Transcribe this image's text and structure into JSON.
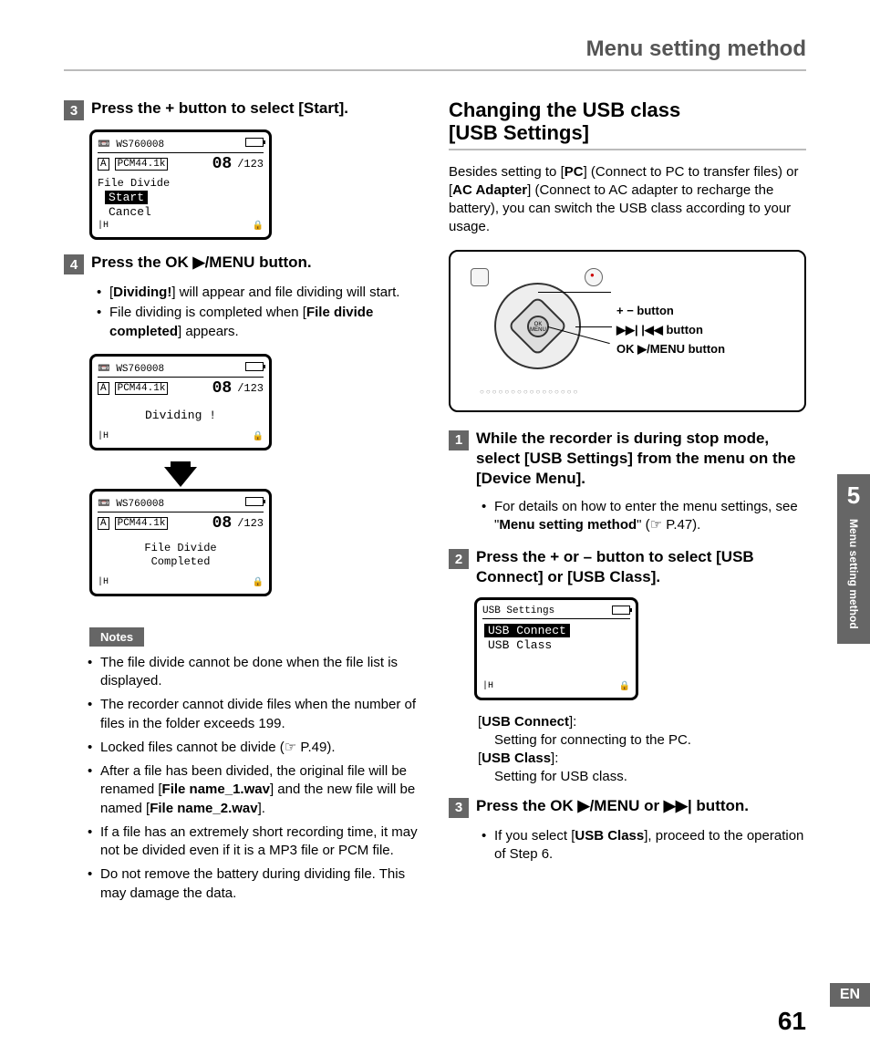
{
  "header": {
    "title": "Menu setting method"
  },
  "left": {
    "step3": {
      "num": "3",
      "text_a": "Press the ",
      "text_b": "+",
      "text_c": " button to select [",
      "text_d": "Start",
      "text_e": "]."
    },
    "screen1": {
      "fname": "WS760008",
      "folder": "A",
      "pcm": "PCM44.1k",
      "count": "08",
      "slash": "/",
      "total": "123",
      "title": "File Divide",
      "opt1": "Start",
      "opt2": "Cancel"
    },
    "step4": {
      "num": "4",
      "text_a": "Press the ",
      "text_b": "OK ▶/MENU",
      "text_c": " button."
    },
    "step4_bullets": [
      {
        "a": "[",
        "b": "Dividing!",
        "c": "] will appear and file dividing will start."
      },
      {
        "a": "File dividing is completed when [",
        "b": "File divide completed",
        "c": "] appears."
      }
    ],
    "screen2": {
      "fname": "WS760008",
      "folder": "A",
      "pcm": "PCM44.1k",
      "count": "08",
      "slash": "/",
      "total": "123",
      "msg": "Dividing !"
    },
    "screen3": {
      "fname": "WS760008",
      "folder": "A",
      "pcm": "PCM44.1k",
      "count": "08",
      "slash": "/",
      "total": "123",
      "msg1": "File Divide",
      "msg2": "Completed"
    },
    "notes_label": "Notes",
    "notes": [
      "The file divide cannot be done when the file list is displayed.",
      "The recorder cannot divide files when the number of files in the folder exceeds 199.",
      "Locked files cannot be divide (☞ P.49).",
      {
        "a": "After a file has been divided, the original file will be renamed [",
        "b": "File name_1.wav",
        "c": "] and the new file will be named [",
        "d": "File name_2.wav",
        "e": "]."
      },
      "If a file has an extremely short recording time, it may not be divided even if it is a MP3 file or PCM file.",
      "Do not remove the battery during dividing file. This may damage the data."
    ]
  },
  "right": {
    "section_title_1": "Changing the USB class",
    "section_title_2": "[USB Settings]",
    "intro": {
      "a": "Besides setting to [",
      "b": "PC",
      "c": "] (Connect to PC to transfer files) or [",
      "d": "AC Adapter",
      "e": "] (Connect to AC adapter to recharge the battery), you can switch the USB class according to your usage."
    },
    "device_labels": {
      "l1": "+ − button",
      "l2": "▶▶| |◀◀ button",
      "l3": "OK ▶/MENU button"
    },
    "step1": {
      "num": "1",
      "a": "While the recorder is during stop mode, select [",
      "b": "USB Settings",
      "c": "] from the menu on the [",
      "d": "Device Menu",
      "e": "]."
    },
    "step1_bullets": [
      {
        "a": "For details on how to enter the menu settings, see \"",
        "b": "Menu setting method",
        "c": "\" (☞ P.47)."
      }
    ],
    "step2": {
      "num": "2",
      "a": "Press the ",
      "b": "+",
      "c": " or ",
      "d": "–",
      "e": " button to select [",
      "f": "USB Connect",
      "g": "] or [",
      "h": "USB Class",
      "i": "]."
    },
    "screen4": {
      "title": "USB Settings",
      "opt1": "USB Connect",
      "opt2": "USB Class"
    },
    "desc": {
      "l1a": "[",
      "l1b": "USB Connect",
      "l1c": "]:",
      "l1d": "Setting for connecting to the PC.",
      "l2a": "[",
      "l2b": "USB Class",
      "l2c": "]:",
      "l2d": "Setting for USB class."
    },
    "step3": {
      "num": "3",
      "a": "Press the ",
      "b": "OK ▶/MENU",
      "c": " or ",
      "d": "▶▶|",
      "e": " button."
    },
    "step3_bullets": [
      {
        "a": "If you select [",
        "b": "USB Class",
        "c": "], proceed to the operation of Step 6."
      }
    ]
  },
  "side_tab": {
    "num": "5",
    "text": "Menu setting method"
  },
  "lang": "EN",
  "page_num": "61"
}
